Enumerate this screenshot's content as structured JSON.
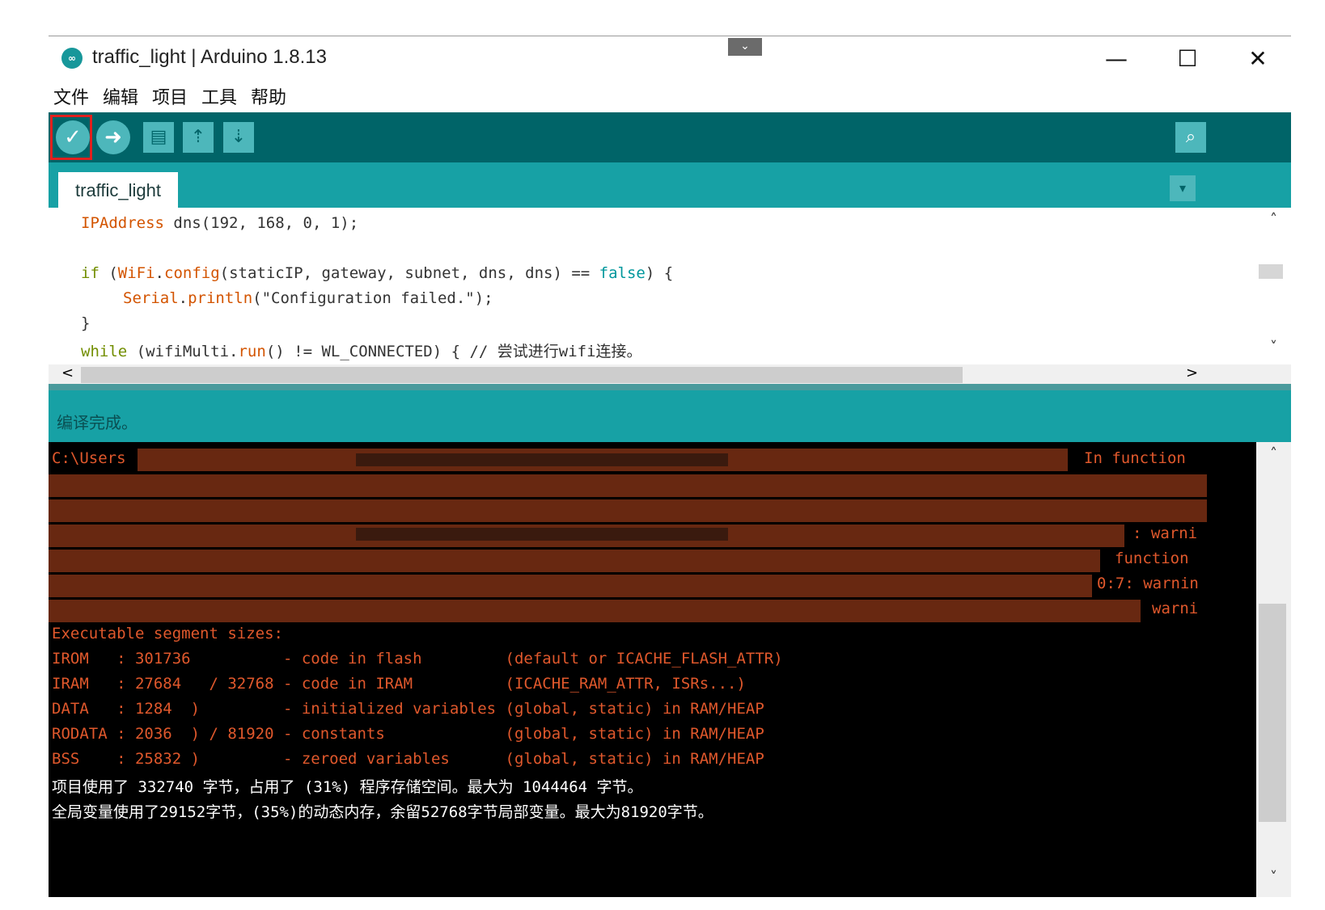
{
  "window": {
    "title": "traffic_light | Arduino 1.8.13",
    "logo_icon": "arduino-logo-icon",
    "collapse_glyph": "⌄",
    "controls": {
      "minimize": "—",
      "maximize": "☐",
      "close": "✕"
    }
  },
  "menu": {
    "file": "文件",
    "edit": "编辑",
    "project": "项目",
    "tools": "工具",
    "help": "帮助"
  },
  "toolbar": {
    "verify_icon": "✓",
    "upload_icon": "➜",
    "new_icon": "▤",
    "open_icon": "⇡",
    "save_icon": "⇣",
    "monitor_icon": "⌕",
    "highlight_color": "#e0201d"
  },
  "tabs": {
    "sketch": "traffic_light",
    "menu_glyph": "▾"
  },
  "editor": {
    "line1": {
      "type": "IPAddress",
      "rest": " dns(192, 168, 0, 1);"
    },
    "line2": {
      "kw": "if",
      "p1": " (",
      "obj": "WiFi",
      "dot": ".",
      "fn": "config",
      "args": "(staticIP, gateway, subnet, dns, dns) == ",
      "val": "false",
      "end": ") {"
    },
    "line3": {
      "obj": "Serial",
      "dot": ".",
      "fn": "println",
      "args": "(\"Configuration failed.\");"
    },
    "line4": "}",
    "line5": {
      "kw": "while",
      "p1": " (wifiMulti.",
      "fn": "run",
      "rest": "() != WL_CONNECTED) { // 尝试进行wifi连接。"
    },
    "scroll_up": "˄",
    "scroll_down": "˅",
    "scroll_left": "<",
    "scroll_right": ">"
  },
  "status": {
    "message": "编译完成。"
  },
  "console": {
    "redacted_line1_prefix": "C:\\Users",
    "redacted_line1_suffix": "In function",
    "redacted_line4_suffix": ": warni",
    "redacted_line5_suffix": "function",
    "redacted_line6_suffix": "0:7: warnin",
    "redacted_line7_suffix": "warni",
    "lines": [
      "Executable segment sizes:",
      "IROM   : 301736          - code in flash         (default or ICACHE_FLASH_ATTR)",
      "IRAM   : 27684   / 32768 - code in IRAM          (ICACHE_RAM_ATTR, ISRs...)",
      "DATA   : 1284  )         - initialized variables (global, static) in RAM/HEAP",
      "RODATA : 2036  ) / 81920 - constants             (global, static) in RAM/HEAP",
      "BSS    : 25832 )         - zeroed variables      (global, static) in RAM/HEAP"
    ],
    "summary1": "项目使用了 332740 字节，占用了 (31%) 程序存储空间。最大为 1044464 字节。",
    "summary2": "全局变量使用了29152字节，(35%)的动态内存，余留52768字节局部变量。最大为81920字节。",
    "text_color": "#e0582c"
  },
  "colors": {
    "toolbar_bg": "#006468",
    "tab_bg": "#17a1a5",
    "button_bg": "#4db7bb"
  }
}
